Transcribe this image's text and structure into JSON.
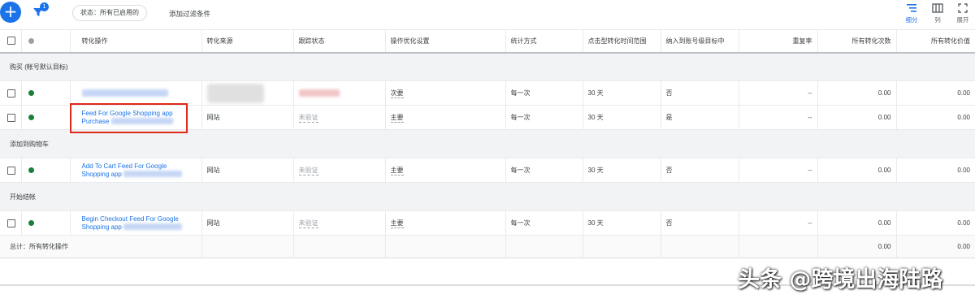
{
  "toolbar": {
    "add_icon": "plus-icon",
    "filter_icon": "filter-icon",
    "filter_badge": "1",
    "status_chip": "状态：所有已启用的",
    "add_filter": "添加过滤条件",
    "views": [
      {
        "label": "细分",
        "icon": "segment-icon",
        "active": true
      },
      {
        "label": "列",
        "icon": "columns-icon",
        "active": false
      },
      {
        "label": "展开",
        "icon": "expand-icon",
        "active": false
      }
    ]
  },
  "table": {
    "headers": [
      "转化操作",
      "转化来源",
      "跟踪状态",
      "操作优化设置",
      "统计方式",
      "点击型转化时间范围",
      "纳入到账号级目标中",
      "重复率",
      "所有转化次数",
      "所有转化价值"
    ],
    "groups": [
      {
        "name": "购买 (帐号默认目标)",
        "rows": [
          {
            "action_line1": "",
            "action_line2": "",
            "source": "",
            "tracking": "",
            "optimization": "次要",
            "counting": "每一次",
            "window": "30 天",
            "include": "否",
            "dup": "--",
            "conversions": "0.00",
            "value": "0.00"
          },
          {
            "action_line1": "Feed For Google Shopping app",
            "action_line2": "Purchase",
            "source": "网站",
            "tracking": "未验证",
            "optimization": "主要",
            "counting": "每一次",
            "window": "30 天",
            "include": "是",
            "dup": "--",
            "conversions": "0.00",
            "value": "0.00"
          }
        ]
      },
      {
        "name": "添加到购物车",
        "rows": [
          {
            "action_line1": "Add To Cart Feed For Google",
            "action_line2": "Shopping app",
            "source": "网站",
            "tracking": "未验证",
            "optimization": "主要",
            "counting": "每一次",
            "window": "30 天",
            "include": "否",
            "dup": "--",
            "conversions": "0.00",
            "value": "0.00"
          }
        ]
      },
      {
        "name": "开始结帐",
        "rows": [
          {
            "action_line1": "Begin Checkout Feed For Google",
            "action_line2": "Shopping app",
            "source": "网站",
            "tracking": "未验证",
            "optimization": "主要",
            "counting": "每一次",
            "window": "30 天",
            "include": "否",
            "dup": "--",
            "conversions": "0.00",
            "value": "0.00"
          }
        ]
      }
    ],
    "total": {
      "label": "总计：所有转化操作",
      "conversions": "0.00",
      "value": "0.00"
    }
  },
  "colors": {
    "accent": "#1a73e8",
    "status_enabled": "#188038",
    "highlight": "#e0281b"
  },
  "watermark": "头条 @跨境出海陆路"
}
